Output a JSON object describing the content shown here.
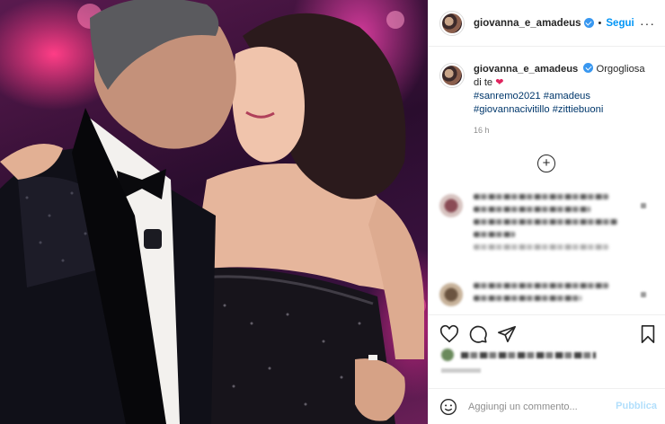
{
  "post": {
    "image_alt": "Amadeus and Giovanna Civitillo embracing on stage"
  },
  "header": {
    "username": "giovanna_e_amadeus",
    "separator": "•",
    "follow_label": "Segui",
    "more_icon": "more-icon"
  },
  "caption": {
    "username": "giovanna_e_amadeus",
    "text": "Orgogliosa di te",
    "heart": "❤",
    "hashtags": [
      "#sanremo2021",
      "#amadeus",
      "#giovannacivitillo",
      "#zittiebuoni"
    ],
    "time": "16 h"
  },
  "load_more": {
    "label": "+"
  },
  "comments": [
    {
      "blurred": true
    },
    {
      "blurred": true
    }
  ],
  "actions": {
    "like_icon": "heart-icon",
    "comment_icon": "comment-icon",
    "share_icon": "share-icon",
    "save_icon": "bookmark-icon"
  },
  "add_comment": {
    "placeholder": "Aggiungi un commento...",
    "publish_label": "Pubblica",
    "emoji_icon": "emoji-icon"
  },
  "colors": {
    "accent": "#0095f6",
    "verified": "#3897f0",
    "publish_disabled": "#b2dffc",
    "border": "#efefef"
  }
}
